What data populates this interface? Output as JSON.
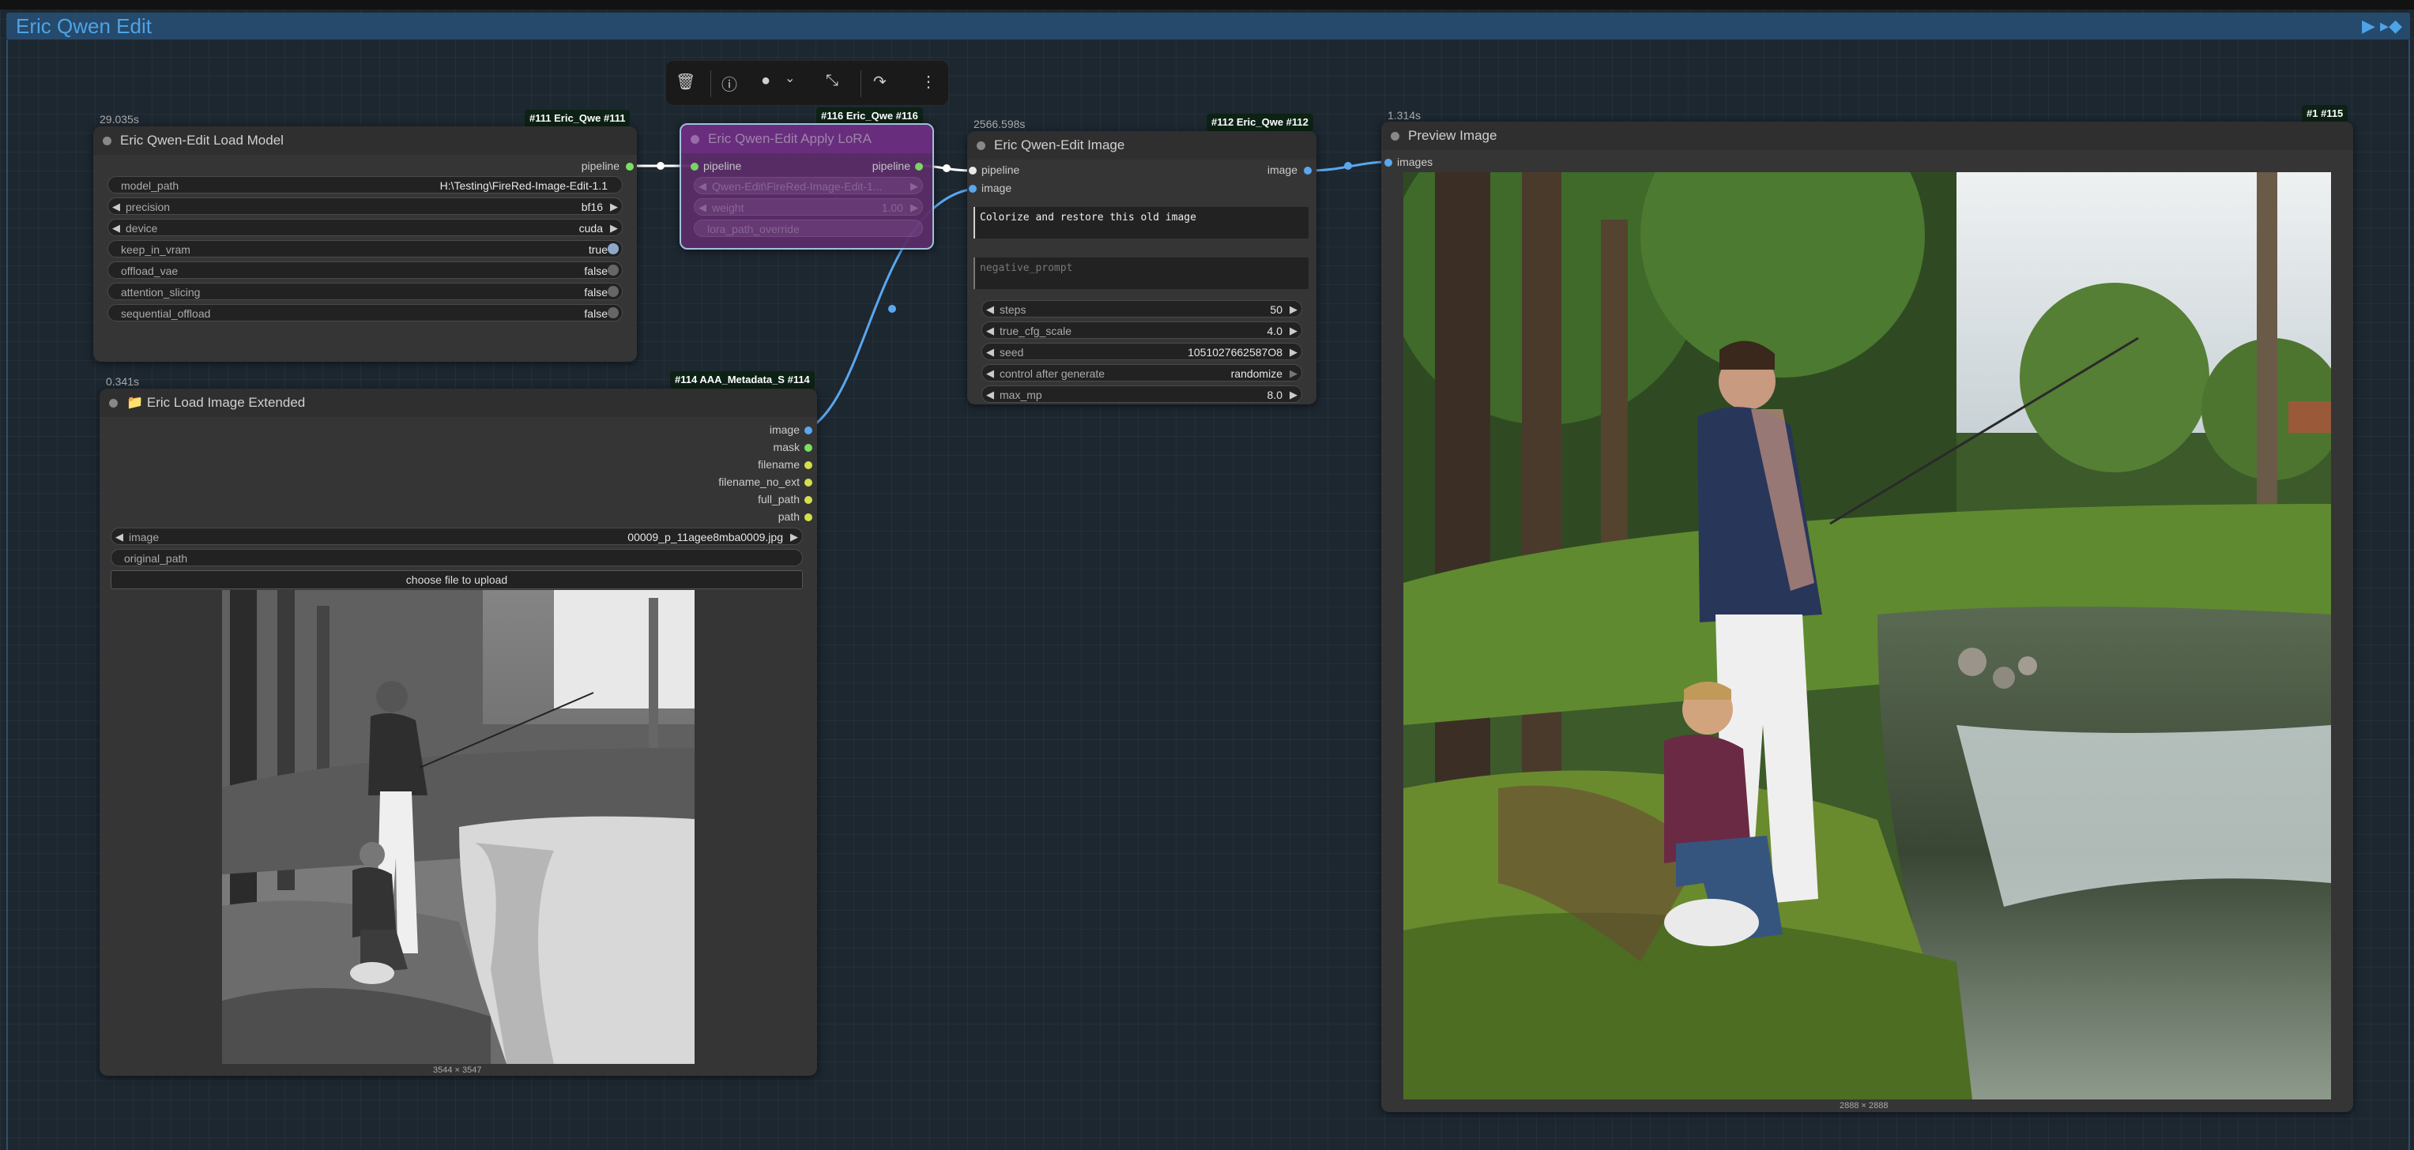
{
  "group": {
    "title": "Eric Qwen Edit",
    "run_icon": "▶",
    "pin_icon": "▸◆"
  },
  "toolbar": {
    "delete_icon": "🗑",
    "info_icon": "ⓘ",
    "color_icon": "●",
    "chevron": "⌄",
    "collapse_icon": "⤡",
    "bypass_icon": "↷",
    "more_icon": "⋮"
  },
  "load_model": {
    "timing": "29.035s",
    "badge": "#111 Eric_Qwe #111",
    "title": "Eric Qwen-Edit Load Model",
    "output": "pipeline",
    "widgets": {
      "model_path": {
        "label": "model_path",
        "value": "H:\\Testing\\FireRed-Image-Edit-1.1"
      },
      "precision": {
        "label": "precision",
        "value": "bf16"
      },
      "device": {
        "label": "device",
        "value": "cuda"
      },
      "keep_in_vram": {
        "label": "keep_in_vram",
        "value": "true"
      },
      "offload_vae": {
        "label": "offload_vae",
        "value": "false"
      },
      "attention_slicing": {
        "label": "attention_slicing",
        "value": "false"
      },
      "sequential_offload": {
        "label": "sequential_offload",
        "value": "false"
      }
    }
  },
  "apply_lora": {
    "badge": "#116 Eric_Qwe #116",
    "title": "Eric Qwen-Edit Apply LoRA",
    "input": "pipeline",
    "output": "pipeline",
    "lora_value": "Qwen-Edit\\FireRed-Image-Edit-1...",
    "weight_label": "weight",
    "weight_value": "1.00",
    "path_override": "lora_path_override"
  },
  "edit_image": {
    "timing": "2566.598s",
    "badge": "#112 Eric_Qwe #112",
    "title": "Eric Qwen-Edit Image",
    "inputs": [
      "pipeline",
      "image"
    ],
    "output": "image",
    "prompt": "Colorize and restore this old image",
    "negative_placeholder": "negative_prompt",
    "widgets": {
      "steps": {
        "label": "steps",
        "value": "50"
      },
      "true_cfg_scale": {
        "label": "true_cfg_scale",
        "value": "4.0"
      },
      "seed": {
        "label": "seed",
        "value": "1051027662587O8"
      },
      "control": {
        "label": "control after generate",
        "value": "randomize"
      },
      "max_mp": {
        "label": "max_mp",
        "value": "8.0"
      }
    }
  },
  "load_image": {
    "timing": "0.341s",
    "badge": "#114 AAA_Metadata_S #114",
    "title": "Eric Load Image Extended",
    "folder_icon": "📁",
    "outputs": [
      "image",
      "mask",
      "filename",
      "filename_no_ext",
      "full_path",
      "path"
    ],
    "image_widget": {
      "label": "image",
      "value": "00009_p_11agee8mba0009.jpg"
    },
    "original_path_label": "original_path",
    "upload_label": "choose file to upload",
    "dims": "3544 × 3547"
  },
  "preview": {
    "timing": "1.314s",
    "badge": "#1 #115",
    "title": "Preview Image",
    "input": "images",
    "dims": "2888 × 2888"
  }
}
